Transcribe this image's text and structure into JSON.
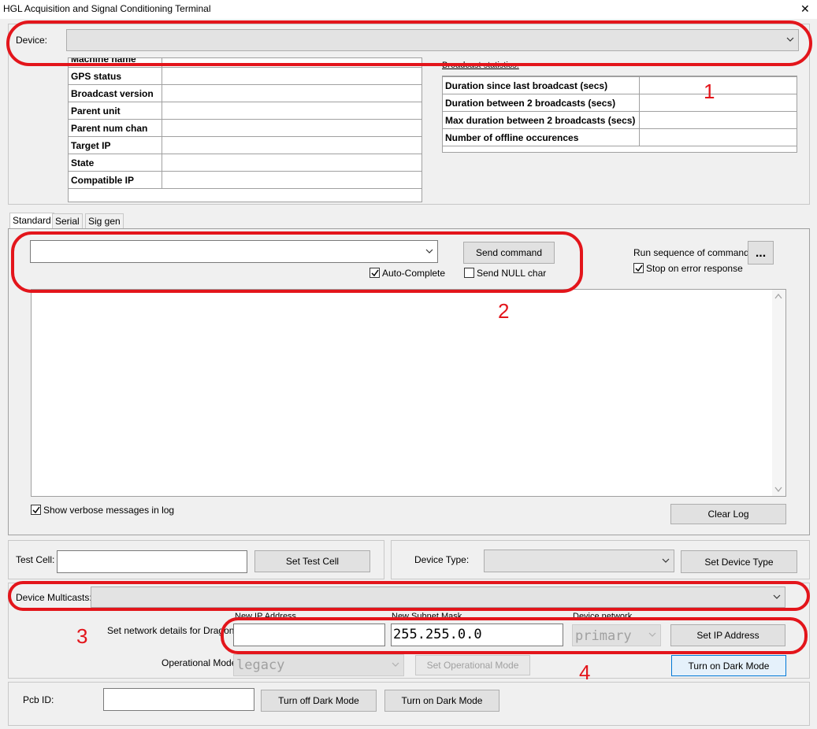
{
  "window": {
    "title": "HGL Acquisition and Signal Conditioning Terminal",
    "close_glyph": "✕"
  },
  "device": {
    "label": "Device:",
    "value": ""
  },
  "info_table": {
    "rows": [
      {
        "label": "Machine name",
        "value": ""
      },
      {
        "label": "GPS status",
        "value": ""
      },
      {
        "label": "Broadcast version",
        "value": ""
      },
      {
        "label": "Parent unit",
        "value": ""
      },
      {
        "label": "Parent num chan",
        "value": ""
      },
      {
        "label": "Target IP",
        "value": ""
      },
      {
        "label": "State",
        "value": ""
      },
      {
        "label": "Compatible IP",
        "value": ""
      }
    ]
  },
  "broadcast": {
    "heading": "Broadcast statistics:",
    "rows": [
      {
        "label": "Duration since last broadcast (secs)",
        "value": ""
      },
      {
        "label": "Duration between 2 broadcasts (secs)",
        "value": ""
      },
      {
        "label": "Max duration between 2 broadcasts (secs)",
        "value": ""
      },
      {
        "label": "Number of offline occurences",
        "value": ""
      }
    ]
  },
  "tabs": [
    {
      "label": "Standard",
      "active": true
    },
    {
      "label": "Serial",
      "active": false
    },
    {
      "label": "Sig gen",
      "active": false
    }
  ],
  "command": {
    "value": "",
    "send_label": "Send command",
    "auto_complete_label": "Auto-Complete",
    "auto_complete_checked": true,
    "send_null_label": "Send NULL char",
    "send_null_checked": false,
    "run_sequence_label": "Run sequence of commands",
    "run_sequence_button": "...",
    "stop_on_error_label": "Stop on error response",
    "stop_on_error_checked": true
  },
  "log": {
    "content": "",
    "verbose_label": "Show verbose messages in log",
    "verbose_checked": true,
    "clear_label": "Clear Log"
  },
  "test_cell": {
    "label": "Test Cell:",
    "value": "",
    "button": "Set Test Cell"
  },
  "device_type": {
    "label": "Device Type:",
    "value": "",
    "button": "Set Device Type"
  },
  "multicasts": {
    "label": "Device Multicasts:",
    "value": ""
  },
  "network": {
    "label": "Set network details for Dragonfly",
    "ip_header": "New IP Address",
    "ip_value": "",
    "subnet_header": "New Subnet Mask",
    "subnet_value": "255.255.0.0",
    "netif_header": "Device network",
    "netif_value": "primary",
    "set_ip_button": "Set IP Address"
  },
  "operational_mode": {
    "label": "Operational Mode",
    "value": "legacy",
    "button": "Set Operational Mode",
    "dark_on_button": "Turn on Dark Mode"
  },
  "pcb": {
    "label": "Pcb ID:",
    "value": "",
    "dark_off_button": "Turn off Dark Mode",
    "dark_on_button": "Turn on Dark Mode"
  },
  "annotations": {
    "n1": "1",
    "n2": "2",
    "n3": "3",
    "n4": "4",
    "color": "#e3151b"
  }
}
